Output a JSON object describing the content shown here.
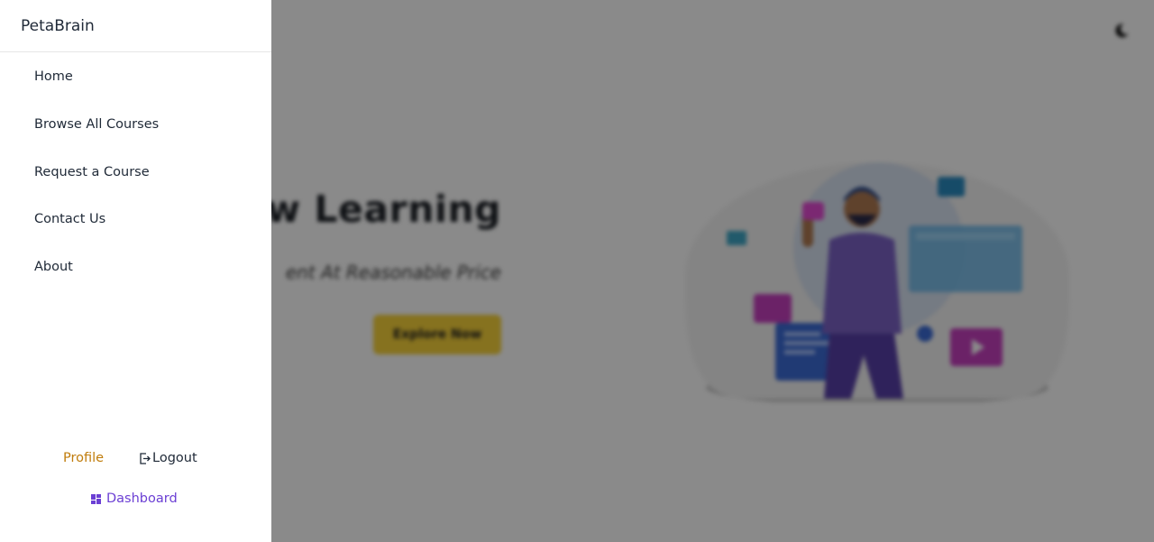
{
  "brand": "PetaBrain",
  "nav": [
    {
      "label": "Home"
    },
    {
      "label": "Browse All Courses"
    },
    {
      "label": "Request a Course"
    },
    {
      "label": "Contact Us"
    },
    {
      "label": "About"
    }
  ],
  "footer_links": {
    "profile": "Profile",
    "logout": "Logout",
    "dashboard": "Dashboard"
  },
  "hero": {
    "title": "ew Learning",
    "subtitle": "ent At Reasonable Price",
    "button": "Explore Now"
  },
  "icons": {
    "theme": "moon-icon",
    "logout": "logout-icon",
    "dashboard": "dashboard-icon"
  },
  "colors": {
    "profile": "#c07c0b",
    "dashboard": "#6b3fd4",
    "explore_button": "#f7d23a"
  }
}
